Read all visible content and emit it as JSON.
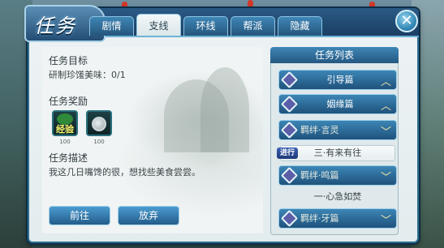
{
  "window": {
    "title": "任务",
    "close_label": "✕"
  },
  "tabs": [
    {
      "label": "剧情",
      "active": false
    },
    {
      "label": "支线",
      "active": true
    },
    {
      "label": "环线",
      "active": false
    },
    {
      "label": "帮派",
      "active": false
    },
    {
      "label": "隐藏",
      "active": false
    }
  ],
  "detail": {
    "goal_heading": "任务目标",
    "goal_text": "研制珍馐美味：0/1",
    "reward_heading": "任务奖励",
    "rewards": [
      {
        "label": "经验",
        "count": "100",
        "icon": "exp-icon"
      },
      {
        "label": "",
        "count": "100",
        "icon": "coins-icon"
      }
    ],
    "desc_heading": "任务描述",
    "desc_text": "我这几日嘴馋的很，想找些美食尝尝。"
  },
  "buttons": {
    "go": "前往",
    "abandon": "放弃"
  },
  "task_list": {
    "title": "任务列表",
    "items": [
      {
        "type": "category",
        "label": "引导篇",
        "chevron": "up"
      },
      {
        "type": "category",
        "label": "姻缘篇",
        "chevron": "up"
      },
      {
        "type": "category",
        "label": "羁绊·言灵",
        "chevron": "down"
      },
      {
        "type": "sub",
        "label": "三·有来有往",
        "badge": "进行"
      },
      {
        "type": "category",
        "label": "羁绊·鸣篇",
        "chevron": "down"
      },
      {
        "type": "sub",
        "label": "一·心急如焚"
      },
      {
        "type": "category",
        "label": "羁绊·牙篇",
        "chevron": "down"
      }
    ]
  },
  "colors": {
    "accent": "#2a5a86",
    "panel": "#eef3f4",
    "chevron": "#f5e7a6"
  }
}
